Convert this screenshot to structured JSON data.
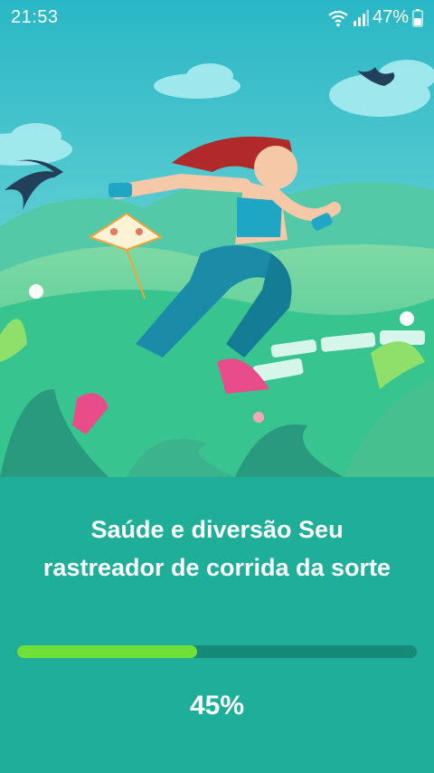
{
  "status_bar": {
    "time": "21:53",
    "battery_percent": "47%",
    "icons": [
      "wifi-icon",
      "signal-icon",
      "battery-icon"
    ]
  },
  "hero": {
    "illustration": "woman-running-in-meadow-illustration"
  },
  "splash": {
    "tagline": "Saúde e diversão Seu rastreador de corrida da sorte",
    "progress_label": "45%",
    "progress_fraction": 0.45
  },
  "colors": {
    "panel_background": "#1fae98",
    "progress_fill": "#6fe03a",
    "progress_track": "#168a76"
  }
}
